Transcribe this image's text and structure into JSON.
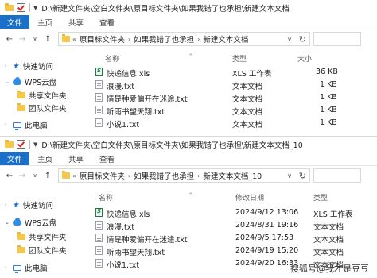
{
  "window_top": {
    "title": "D:\\新建文件夹\\空白文件夹\\原目标文件夹\\如果我错了也承担\\新建文本文档",
    "ribbon_tabs": [
      "文件",
      "主页",
      "共享",
      "查看"
    ],
    "breadcrumb": [
      "原目标文件夹",
      "如果我错了也承担",
      "新建文本文档"
    ],
    "sidebar": {
      "quick_access": "快速访问",
      "wps_cloud": "WPS云盘",
      "shared_folder": "共享文件夹",
      "team_folder": "团队文件夹",
      "this_pc": "此电脑"
    },
    "columns": {
      "name": "名称",
      "type": "类型",
      "size": "大小"
    },
    "files": [
      {
        "name": "快递信息.xls",
        "type": "XLS 工作表",
        "size": "36 KB",
        "icon": "xls-file-icon"
      },
      {
        "name": "浪漫.txt",
        "type": "文本文档",
        "size": "1 KB",
        "icon": "txt-file-icon"
      },
      {
        "name": "情是种爱偏开在迷途.txt",
        "type": "文本文档",
        "size": "1 KB",
        "icon": "txt-file-icon"
      },
      {
        "name": "听雨书望天翔.txt",
        "type": "文本文档",
        "size": "1 KB",
        "icon": "txt-file-icon"
      },
      {
        "name": "小说1.txt",
        "type": "文本文档",
        "size": "1 KB",
        "icon": "txt-file-icon"
      }
    ]
  },
  "window_bottom": {
    "title": "D:\\新建文件夹\\空白文件夹\\原目标文件夹\\如果我错了也承担\\新建文本文档_10",
    "ribbon_tabs": [
      "文件",
      "主页",
      "共享",
      "查看"
    ],
    "breadcrumb": [
      "原目标文件夹",
      "如果我错了也承担",
      "新建文本文档_10"
    ],
    "sidebar": {
      "quick_access": "快速访问",
      "wps_cloud": "WPS云盘",
      "shared_folder": "共享文件夹",
      "team_folder": "团队文件夹",
      "this_pc": "此电脑"
    },
    "columns": {
      "name": "名称",
      "modified": "修改日期",
      "type": "类型"
    },
    "files": [
      {
        "name": "快递信息.xls",
        "modified": "2024/9/12 13:06",
        "type": "XLS 工作表",
        "icon": "xls-file-icon"
      },
      {
        "name": "浪漫.txt",
        "modified": "2024/8/31 19:16",
        "type": "文本文档",
        "icon": "txt-file-icon"
      },
      {
        "name": "情是种爱偏开在迷途.txt",
        "modified": "2024/9/5 17:53",
        "type": "文本文档",
        "icon": "txt-file-icon"
      },
      {
        "name": "听雨书望天翔.txt",
        "modified": "2024/9/19 15:20",
        "type": "文本文档",
        "icon": "txt-file-icon"
      },
      {
        "name": "小说1.txt",
        "modified": "2024/9/20 16:33",
        "type": "文本文档",
        "icon": "txt-file-icon"
      }
    ]
  },
  "watermark": "搜狐号@我才是豆豆",
  "colors": {
    "file_tab": "#1a6fc9",
    "folder": "#f4c84a"
  }
}
